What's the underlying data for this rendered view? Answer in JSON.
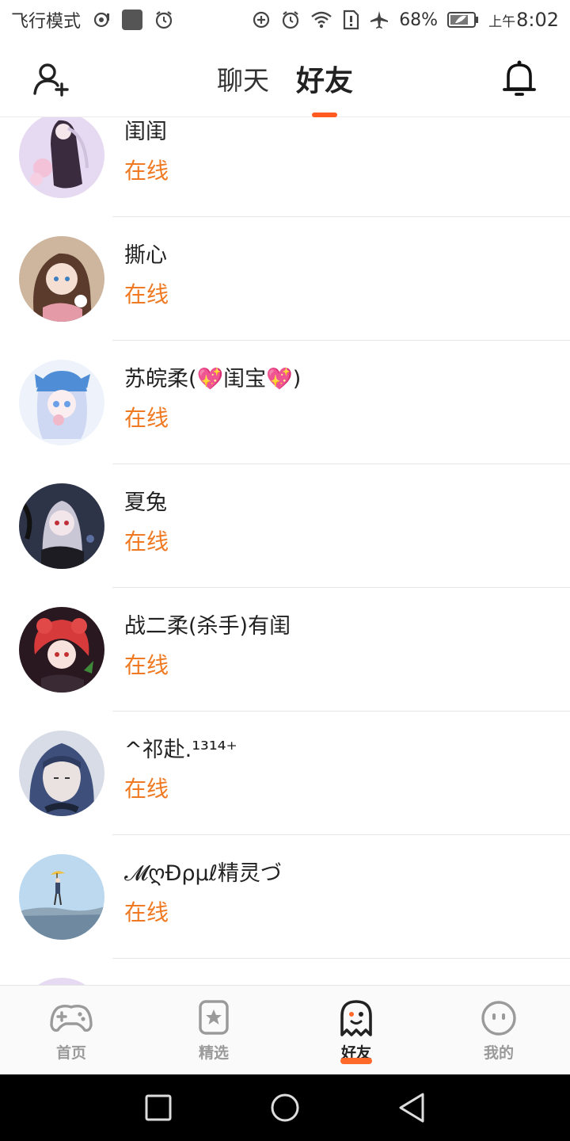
{
  "status_bar": {
    "airplane_mode_label": "飞行模式",
    "battery_percent": "68%",
    "time_prefix": "上午",
    "time": "8:02",
    "icons": [
      "hotspot-icon",
      "app-icon",
      "alarm-icon",
      "data-saver-icon",
      "alarm-icon",
      "wifi-icon",
      "sim-alert-icon",
      "airplane-icon",
      "battery-icon"
    ]
  },
  "header": {
    "tabs": [
      {
        "label": "聊天",
        "active": false
      },
      {
        "label": "好友",
        "active": true
      }
    ],
    "left_icon": "add-friend-icon",
    "right_icon": "bell-icon",
    "accent_color": "#ff5a1f"
  },
  "friends": [
    {
      "name": "闺闺",
      "status": "在线"
    },
    {
      "name": "撕心",
      "status": "在线"
    },
    {
      "name": "苏皖柔(💖闺宝💖)",
      "status": "在线"
    },
    {
      "name": "夏兔",
      "status": "在线"
    },
    {
      "name": "战二柔(杀手)有闺",
      "status": "在线"
    },
    {
      "name": "^祁赴.¹³¹⁴⁺",
      "status": "在线"
    },
    {
      "name": "𝓜ღÐρμℓ精灵づ",
      "status": "在线"
    }
  ],
  "status_color": "#ef7a22",
  "bottom_nav": [
    {
      "label": "首页",
      "icon": "gamepad-icon",
      "active": false
    },
    {
      "label": "精选",
      "icon": "star-card-icon",
      "active": false
    },
    {
      "label": "好友",
      "icon": "ghost-icon",
      "active": true
    },
    {
      "label": "我的",
      "icon": "face-icon",
      "active": false
    }
  ],
  "system_nav": [
    "recents-button",
    "home-button",
    "back-button"
  ]
}
